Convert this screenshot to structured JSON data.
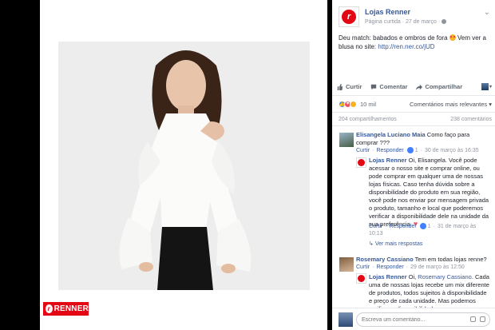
{
  "brand": {
    "badge": "RENNER",
    "accent": "#e30613"
  },
  "post": {
    "page_name": "Lojas Renner",
    "page_meta": "Página curtida · 27 de março ·",
    "caption_text": "Deu match: babados e ombros de fora",
    "caption_text2": " Vem ver a blusa no site:",
    "caption_link": "http://ren.ner.co/jUD",
    "emoji": "heart-eyes-emoji"
  },
  "actions": {
    "like": "Curtir",
    "comment": "Comentar",
    "share": "Compartilhar"
  },
  "reactions": {
    "count": "10 mil",
    "sort": "Comentários mais relevantes ▾"
  },
  "stats": {
    "shares": "204 compartilhamentos",
    "comments": "238 comentários"
  },
  "comments": [
    {
      "author": "Elisangela Luciano Maia",
      "text": "Como faço para comprar ???",
      "reply_label": "Curtir",
      "answer_label": "Responder",
      "likes": "1",
      "time": "30 de março às 16:35",
      "reply": {
        "author": "Lojas Renner",
        "text": "Oi, Elisangela. Você pode acessar o nosso site e comprar online, ou pode comprar em qualquer uma de nossas lojas físicas. Caso tenha dúvida sobre a disponibilidade do produto em sua região, você pode nos enviar por mensagem privada o produto, tamanho e local que poderemos verificar a disponibilidade dele na unidade da sua preferência.",
        "like_label": "Curtir",
        "answer_label": "Responder",
        "likes": "1",
        "time": "31 de março às",
        "time2": "10:13"
      },
      "more": "Ver mais respostas"
    },
    {
      "author": "Rosemary Cassiano",
      "text": "Tem em todas lojas renne?",
      "like_label": "Curtir",
      "answer_label": "Responder",
      "time": "29 de março às 12:50",
      "reply": {
        "author": "Lojas Renner",
        "mention": "Rosemary Cassiano",
        "text_pre": "Oi, ",
        "text": ". Cada uma de nossas lojas recebe um mix diferente de produtos, todos sujeitos à disponibilidade e preço de cada unidade. Mas podemos verificar a disponibilidade"
      }
    }
  ],
  "composer": {
    "placeholder": "Escreva um comentário..."
  }
}
